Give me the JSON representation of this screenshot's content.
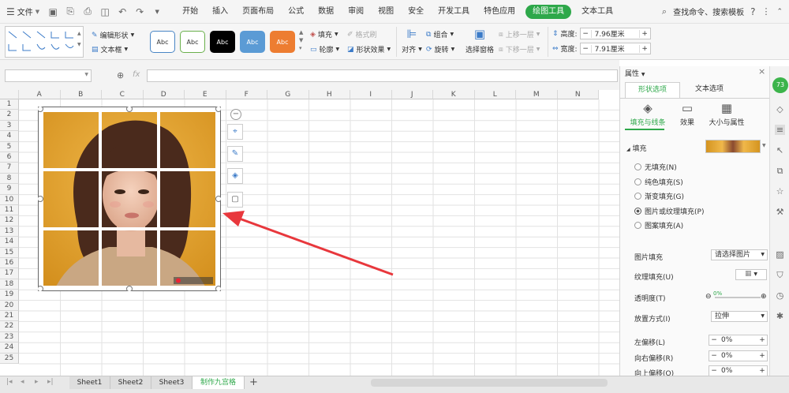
{
  "menubar": {
    "file_label": "文件",
    "items": [
      "开始",
      "插入",
      "页面布局",
      "公式",
      "数据",
      "审阅",
      "视图",
      "安全",
      "开发工具",
      "特色应用",
      "绘图工具",
      "文本工具"
    ],
    "active_index": 10,
    "search_label": "查找命令、搜索模板"
  },
  "ribbon": {
    "edit_shape": "编辑形状",
    "text_box": "文本框",
    "style_label": "Abc",
    "fill": "填充",
    "format_brush": "格式刷",
    "outline": "轮廓",
    "shape_effect": "形状效果",
    "align": "对齐",
    "group": "组合",
    "rotate": "旋转",
    "selection_pane": "选择窗格",
    "bring_forward": "上移一层",
    "send_backward": "下移一层",
    "height_label": "高度:",
    "height_value": "7.96厘米",
    "width_label": "宽度:",
    "width_value": "7.91厘米"
  },
  "formula": {
    "fx": "fx"
  },
  "columns": [
    "A",
    "B",
    "C",
    "D",
    "E",
    "F",
    "G",
    "H",
    "I",
    "J",
    "K",
    "L",
    "M",
    "N"
  ],
  "rows": [
    "1",
    "2",
    "3",
    "4",
    "5",
    "6",
    "7",
    "8",
    "9",
    "10",
    "11",
    "12",
    "13",
    "14",
    "15",
    "16",
    "17",
    "18",
    "19",
    "20",
    "21",
    "22",
    "23",
    "24",
    "25"
  ],
  "picture": {
    "watermark": "事 知乎 九宫"
  },
  "tabs": [
    "Sheet1",
    "Sheet2",
    "Sheet3",
    "制作九宫格"
  ],
  "active_tab": 3,
  "panel": {
    "title": "属性",
    "tab_shape": "形状选项",
    "tab_text": "文本选项",
    "sub_fill_line": "填充与线条",
    "sub_effect": "效果",
    "sub_size": "大小与属性",
    "fill_header": "填充",
    "fill_options": [
      "无填充(N)",
      "纯色填充(S)",
      "渐变填充(G)",
      "图片或纹理填充(P)",
      "图案填充(A)"
    ],
    "fill_selected": 3,
    "picture_fill_label": "图片填充",
    "picture_fill_value": "请选择图片",
    "texture_fill_label": "纹理填充(U)",
    "transparency_label": "透明度(T)",
    "transparency_value": "0%",
    "placement_label": "放置方式(I)",
    "placement_value": "拉伸",
    "left_offset_label": "左偏移(L)",
    "left_offset_value": "0%",
    "right_offset_label": "向右偏移(R)",
    "right_offset_value": "0%",
    "up_offset_label": "向上偏移(O)",
    "up_offset_value": "0%"
  },
  "sidebar": {
    "badge": "73"
  },
  "colors": {
    "accent": "#2ea84a",
    "arrow": "#e8373c"
  }
}
